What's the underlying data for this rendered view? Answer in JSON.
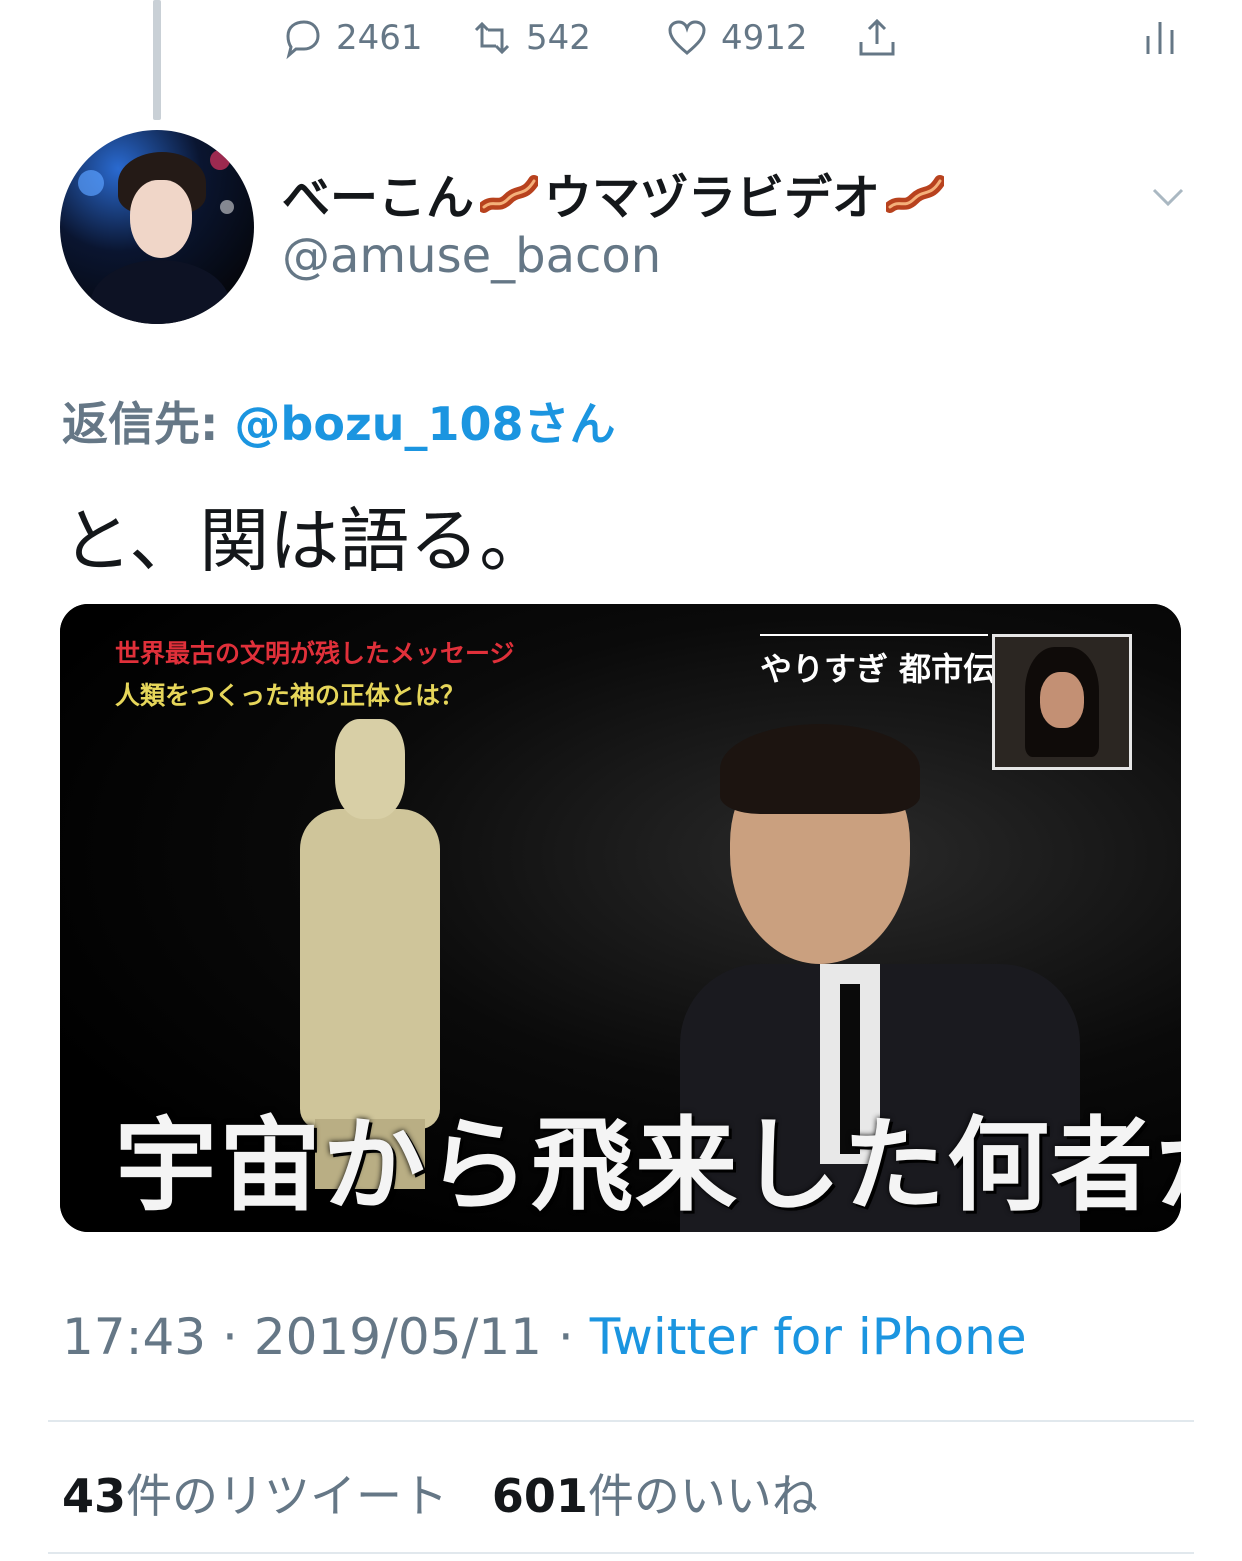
{
  "top_actions": {
    "reply_count": "2461",
    "retweet_count": "542",
    "like_count": "4912",
    "reply_icon": "speech-bubble-icon",
    "retweet_icon": "retweet-icon",
    "like_icon": "heart-icon",
    "share_icon": "share-icon",
    "analytics_icon": "analytics-icon"
  },
  "tweet": {
    "display_name": "べーこん",
    "display_name_mid": "ウマヅラビデオ",
    "emoji": "bacon-emoji",
    "handle": "@amuse_bacon",
    "reply_label": "返信先:",
    "reply_mention": "@bozu_108さん",
    "text": "と、関は語る。",
    "media": {
      "caption_line1": "世界最古の文明が残したメッセージ",
      "caption_line2": "人類をつくった神の正体とは？",
      "show_logo": "やりすぎ 都市伝説",
      "subtitle": "宇宙から飛来した何者か"
    },
    "time": "17:43",
    "separator": "·",
    "date": "2019/05/11",
    "source": "Twitter for iPhone",
    "retweets_num": "43",
    "retweets_label": "件のリツイート",
    "likes_num": "601",
    "likes_label": "件のいいね"
  },
  "colors": {
    "link": "#1b95e0",
    "muted": "#657786",
    "text": "#14171a"
  }
}
